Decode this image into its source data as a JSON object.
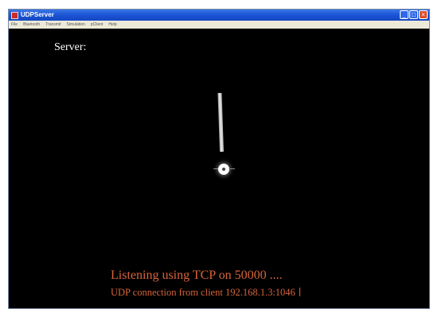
{
  "window": {
    "title": "UDPServer",
    "icon": "app-icon"
  },
  "window_controls": {
    "minimize": "_",
    "maximize": "□",
    "close": "×"
  },
  "menu": {
    "items": [
      "File",
      "Bluetooth",
      "Transmit",
      "Simulation",
      "pClient",
      "Help"
    ]
  },
  "canvas": {
    "server_label": "Server:",
    "status_line1": "Listening using TCP on 50000 ....",
    "status_line2": "UDP connection from client 192.168.1.3:1046"
  },
  "colors": {
    "background": "#000000",
    "status_text": "#d8643a",
    "titlebar": "#1c55d6"
  }
}
